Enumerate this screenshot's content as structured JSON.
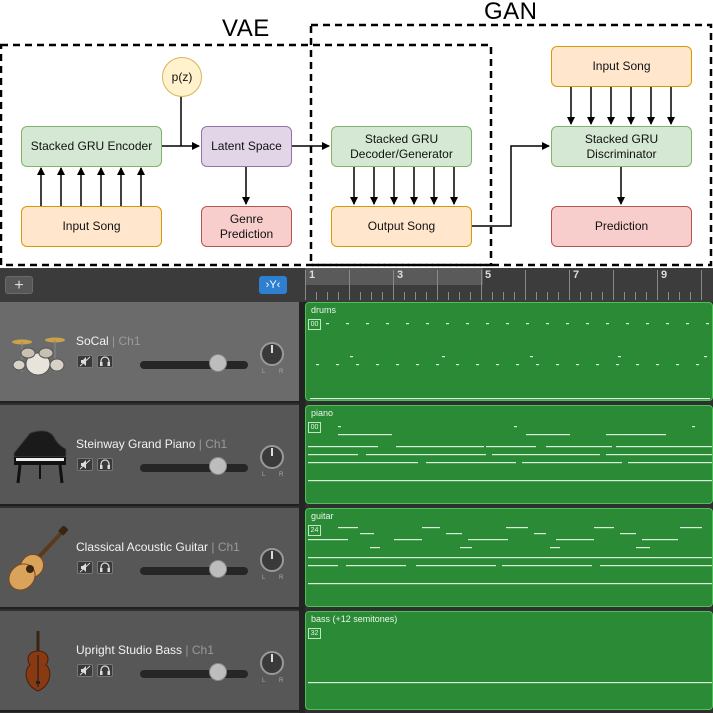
{
  "diagram": {
    "vae_label": "VAE",
    "gan_label": "GAN",
    "nodes": {
      "pz": "p(z)",
      "encoder": "Stacked GRU Encoder",
      "latent": "Latent Space",
      "genre_line1": "Genre",
      "genre_line2": "Prediction",
      "input_song_left": "Input Song",
      "decoder_line1": "Stacked GRU",
      "decoder_line2": "Decoder/Generator",
      "output_song": "Output Song",
      "input_song_right": "Input Song",
      "discriminator_line1": "Stacked GRU",
      "discriminator_line2": "Discriminator",
      "prediction": "Prediction"
    },
    "colors": {
      "green": "#d5e8d4",
      "orange": "#ffe6cc",
      "purple": "#e1d5e7",
      "red": "#f8cecc",
      "yellow": "#fff2cc"
    }
  },
  "daw": {
    "add_button": "+",
    "filter_button": "›Y‹",
    "ruler_numbers": [
      "1",
      "3",
      "5",
      "7",
      "9"
    ],
    "tracks": [
      {
        "name": "SoCal",
        "channel": "| Ch1",
        "region_label": "drums",
        "region_box": "00",
        "volume": 0.72
      },
      {
        "name": "Steinway Grand Piano",
        "channel": "| Ch1",
        "region_label": "piano",
        "region_box": "00",
        "volume": 0.72
      },
      {
        "name": "Classical Acoustic Guitar",
        "channel": "| Ch1",
        "region_label": "guitar",
        "region_box": "24",
        "volume": 0.72
      },
      {
        "name": "Upright Studio Bass",
        "channel": "| Ch1",
        "region_label": "bass (+12 semitones)",
        "region_box": "32",
        "volume": 0.72
      }
    ],
    "mute_icon": "mute-icon",
    "headphones_icon": "headphones-icon",
    "knob_left": "L",
    "knob_right": "R",
    "region_color": "#2a8a35"
  }
}
